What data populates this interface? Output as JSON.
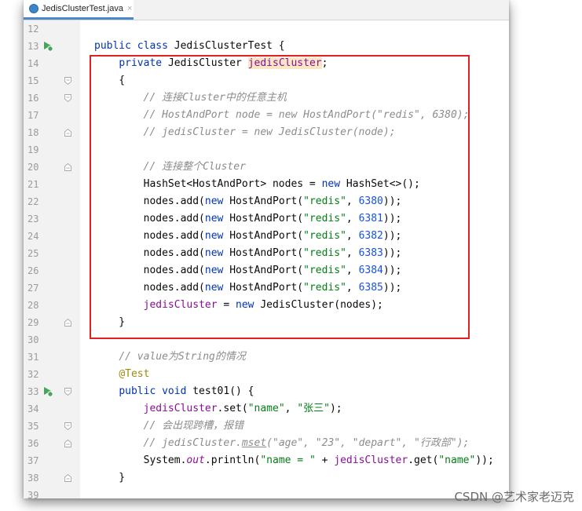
{
  "editor": {
    "tab_title": "JedisClusterTest.java",
    "tab_close": "×"
  },
  "lines": [
    {
      "n": "12",
      "tokens": []
    },
    {
      "n": "13",
      "icon": "run",
      "tokens": [
        [
          "kw",
          "public class "
        ],
        [
          "",
          "JedisClusterTest {"
        ]
      ]
    },
    {
      "n": "14",
      "tokens": [
        [
          "",
          "    "
        ],
        [
          "kw",
          "private "
        ],
        [
          "",
          "JedisCluster "
        ],
        [
          "fldhl",
          "jedisCluster"
        ],
        [
          "",
          ";"
        ]
      ]
    },
    {
      "n": "15",
      "fold": "open",
      "tokens": [
        [
          "",
          "    {"
        ]
      ]
    },
    {
      "n": "16",
      "fold": "open",
      "tokens": [
        [
          "",
          "        "
        ],
        [
          "cmt",
          "// 连接Cluster中的任意主机"
        ]
      ]
    },
    {
      "n": "17",
      "tokens": [
        [
          "",
          "        "
        ],
        [
          "cmt",
          "// HostAndPort node = new HostAndPort(\"redis\", 6380);"
        ]
      ]
    },
    {
      "n": "18",
      "fold": "close",
      "tokens": [
        [
          "",
          "        "
        ],
        [
          "cmt",
          "// jedisCluster = new JedisCluster(node);"
        ]
      ]
    },
    {
      "n": "19",
      "tokens": []
    },
    {
      "n": "20",
      "fold": "close",
      "tokens": [
        [
          "",
          "        "
        ],
        [
          "cmt",
          "// 连接整个Cluster"
        ]
      ]
    },
    {
      "n": "21",
      "tokens": [
        [
          "",
          "        HashSet<HostAndPort> nodes = "
        ],
        [
          "kw",
          "new "
        ],
        [
          "",
          "HashSet<>();"
        ]
      ]
    },
    {
      "n": "22",
      "tokens": [
        [
          "",
          "        nodes.add("
        ],
        [
          "kw",
          "new "
        ],
        [
          "",
          "HostAndPort("
        ],
        [
          "str",
          "\"redis\""
        ],
        [
          "",
          ", "
        ],
        [
          "num",
          "6380"
        ],
        [
          "",
          "));"
        ]
      ]
    },
    {
      "n": "23",
      "tokens": [
        [
          "",
          "        nodes.add("
        ],
        [
          "kw",
          "new "
        ],
        [
          "",
          "HostAndPort("
        ],
        [
          "str",
          "\"redis\""
        ],
        [
          "",
          ", "
        ],
        [
          "num",
          "6381"
        ],
        [
          "",
          "));"
        ]
      ]
    },
    {
      "n": "24",
      "tokens": [
        [
          "",
          "        nodes.add("
        ],
        [
          "kw",
          "new "
        ],
        [
          "",
          "HostAndPort("
        ],
        [
          "str",
          "\"redis\""
        ],
        [
          "",
          ", "
        ],
        [
          "num",
          "6382"
        ],
        [
          "",
          "));"
        ]
      ]
    },
    {
      "n": "25",
      "tokens": [
        [
          "",
          "        nodes.add("
        ],
        [
          "kw",
          "new "
        ],
        [
          "",
          "HostAndPort("
        ],
        [
          "str",
          "\"redis\""
        ],
        [
          "",
          ", "
        ],
        [
          "num",
          "6383"
        ],
        [
          "",
          "));"
        ]
      ]
    },
    {
      "n": "26",
      "tokens": [
        [
          "",
          "        nodes.add("
        ],
        [
          "kw",
          "new "
        ],
        [
          "",
          "HostAndPort("
        ],
        [
          "str",
          "\"redis\""
        ],
        [
          "",
          ", "
        ],
        [
          "num",
          "6384"
        ],
        [
          "",
          "));"
        ]
      ]
    },
    {
      "n": "27",
      "tokens": [
        [
          "",
          "        nodes.add("
        ],
        [
          "kw",
          "new "
        ],
        [
          "",
          "HostAndPort("
        ],
        [
          "str",
          "\"redis\""
        ],
        [
          "",
          ", "
        ],
        [
          "num",
          "6385"
        ],
        [
          "",
          "));"
        ]
      ]
    },
    {
      "n": "28",
      "tokens": [
        [
          "",
          "        "
        ],
        [
          "fld",
          "jedisCluster"
        ],
        [
          "",
          " = "
        ],
        [
          "kw",
          "new "
        ],
        [
          "",
          "JedisCluster(nodes);"
        ]
      ]
    },
    {
      "n": "29",
      "fold": "close",
      "tokens": [
        [
          "",
          "    }"
        ]
      ]
    },
    {
      "n": "30",
      "tokens": []
    },
    {
      "n": "31",
      "tokens": [
        [
          "",
          "    "
        ],
        [
          "cmt",
          "// value为String的情况"
        ]
      ]
    },
    {
      "n": "32",
      "tokens": [
        [
          "",
          "    "
        ],
        [
          "ann",
          "@Test"
        ]
      ]
    },
    {
      "n": "33",
      "icon": "run",
      "fold": "open",
      "tokens": [
        [
          "",
          "    "
        ],
        [
          "kw",
          "public void "
        ],
        [
          "",
          "test01() {"
        ]
      ]
    },
    {
      "n": "34",
      "tokens": [
        [
          "",
          "        "
        ],
        [
          "fld",
          "jedisCluster"
        ],
        [
          "",
          ".set("
        ],
        [
          "str",
          "\"name\""
        ],
        [
          "",
          ", "
        ],
        [
          "str",
          "\"张三\""
        ],
        [
          "",
          ");"
        ]
      ]
    },
    {
      "n": "35",
      "fold": "open",
      "tokens": [
        [
          "",
          "        "
        ],
        [
          "cmt",
          "// 会出现跨槽，报错"
        ]
      ]
    },
    {
      "n": "36",
      "fold": "close",
      "tokens": [
        [
          "",
          "        "
        ],
        [
          "cmt",
          "// jedisCluster."
        ],
        [
          "cmt underline",
          "mset"
        ],
        [
          "cmt",
          "(\"age\", \"23\", \"depart\", \"行政部\");"
        ]
      ]
    },
    {
      "n": "37",
      "tokens": [
        [
          "",
          "        System."
        ],
        [
          "fld italic",
          "out"
        ],
        [
          "",
          ".println("
        ],
        [
          "str",
          "\"name = \""
        ],
        [
          "",
          " + "
        ],
        [
          "fld",
          "jedisCluster"
        ],
        [
          "",
          ".get("
        ],
        [
          "str",
          "\"name\""
        ],
        [
          "",
          "));"
        ]
      ]
    },
    {
      "n": "38",
      "fold": "close",
      "tokens": [
        [
          "",
          "    }"
        ]
      ]
    },
    {
      "n": "39",
      "tokens": []
    }
  ],
  "watermark": "CSDN @艺术家老迈克"
}
